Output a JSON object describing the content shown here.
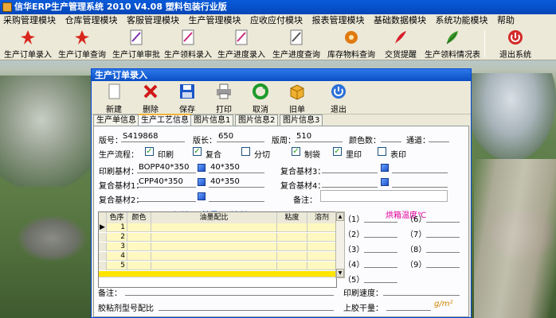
{
  "window": {
    "title": "信华ERP生产管理系统   2010 V4.08  塑料包装行业版"
  },
  "menu": [
    "采购管理模块",
    "仓库管理模块",
    "客服管理模块",
    "生产管理模块",
    "应收应付模块",
    "报表管理模块",
    "基础数据模块",
    "系统功能模块",
    "帮助"
  ],
  "toolbar": [
    {
      "label": "生产订单录入",
      "icon": "pdf-icon"
    },
    {
      "label": "生产订单查询",
      "icon": "pdf-icon"
    },
    {
      "label": "生产订单审批",
      "icon": "document-icon"
    },
    {
      "label": "生产领料录入",
      "icon": "document-icon"
    },
    {
      "label": "生产进度录入",
      "icon": "document-icon"
    },
    {
      "label": "生产进度查询",
      "icon": "document-icon"
    },
    {
      "label": "库存物料查询",
      "icon": "gear-icon"
    },
    {
      "label": "交货提醒",
      "icon": "feather-icon"
    },
    {
      "label": "生产领料情况表",
      "icon": "leaf-icon"
    },
    {
      "label": "退出系统",
      "icon": "exit-icon"
    }
  ],
  "child": {
    "title": "生产订单录入",
    "buttons": [
      "新建",
      "删除",
      "保存",
      "打印",
      "取消",
      "旧单",
      "退出"
    ],
    "tabs": [
      "生产单信息",
      "生产工艺信息",
      "图片信息1",
      "图片信息2",
      "图片信息3"
    ],
    "active_tab": 1
  },
  "form": {
    "order_no_label": "版号：",
    "order_no": "S419868",
    "length_label": "版长：",
    "length": "650",
    "circ_label": "版周：",
    "circ": "510",
    "colors_label": "颜色数：",
    "colors": "",
    "channel_label": "通道：",
    "channel": "",
    "process_label": "生产流程：",
    "process": [
      {
        "label": "印刷",
        "checked": true
      },
      {
        "label": "复合",
        "checked": true
      },
      {
        "label": "分切",
        "checked": false
      },
      {
        "label": "制袋",
        "checked": true
      },
      {
        "label": "里印",
        "checked": true
      },
      {
        "label": "表印",
        "checked": false
      }
    ],
    "print_sub_label": "印刷基材：",
    "print_sub": "BOPP40*350",
    "print_sub_size": "40*350",
    "comp1_label": "复合基材1：",
    "comp1": "CPP40*350",
    "comp1_size": "40*350",
    "comp2_label": "复合基材2：",
    "comp3_label": "复合基材3：",
    "comp4_label": "复合基材4：",
    "note_label": "备注："
  },
  "section": {
    "print": "印刷",
    "ink": "油墨",
    "solvent": "溶剂",
    "oven": "烘箱温度℃"
  },
  "grid": {
    "headers": [
      "色序",
      "颜色",
      "油墨配比",
      "粘度",
      "溶剂"
    ],
    "rows": [
      "1",
      "2",
      "3",
      "4",
      "5"
    ]
  },
  "oven_slots": [
    "（1）",
    "（6）",
    "（2）",
    "（7）",
    "（3）",
    "（8）",
    "（4）",
    "（9）",
    "（5）"
  ],
  "bottom": {
    "note_label": "备注：",
    "print_speed_label": "印刷速度：",
    "glue_label": "胶粘剂型号配比",
    "glue_amount_label": "上胶干量：",
    "unit": "g/m²"
  }
}
